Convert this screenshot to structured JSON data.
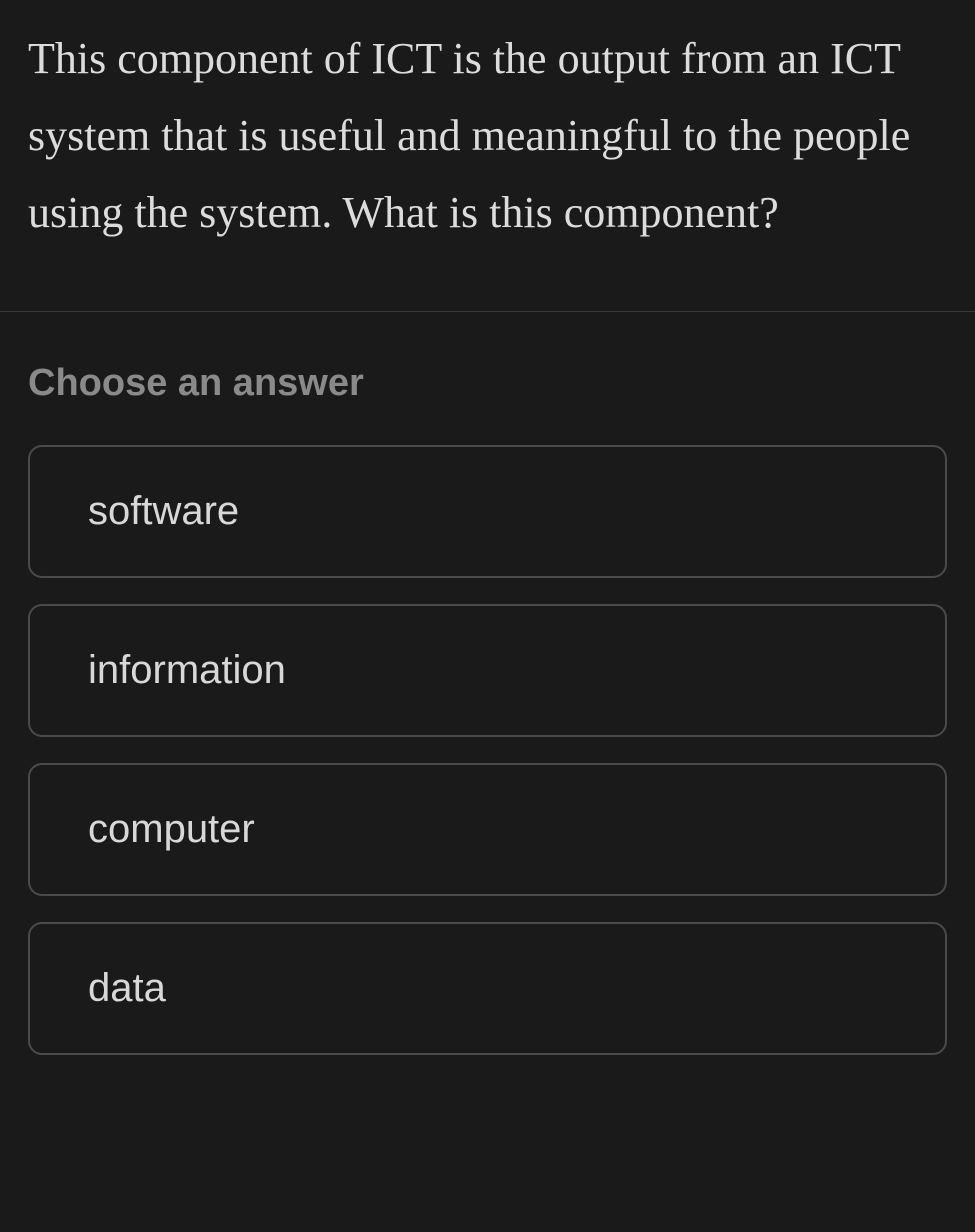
{
  "question": {
    "text": "This component of ICT is the output from an ICT system that is useful and meaningful to the people using the system. What is this component?"
  },
  "answer_prompt": "Choose an answer",
  "answers": [
    {
      "label": "software"
    },
    {
      "label": "information"
    },
    {
      "label": "computer"
    },
    {
      "label": "data"
    }
  ]
}
